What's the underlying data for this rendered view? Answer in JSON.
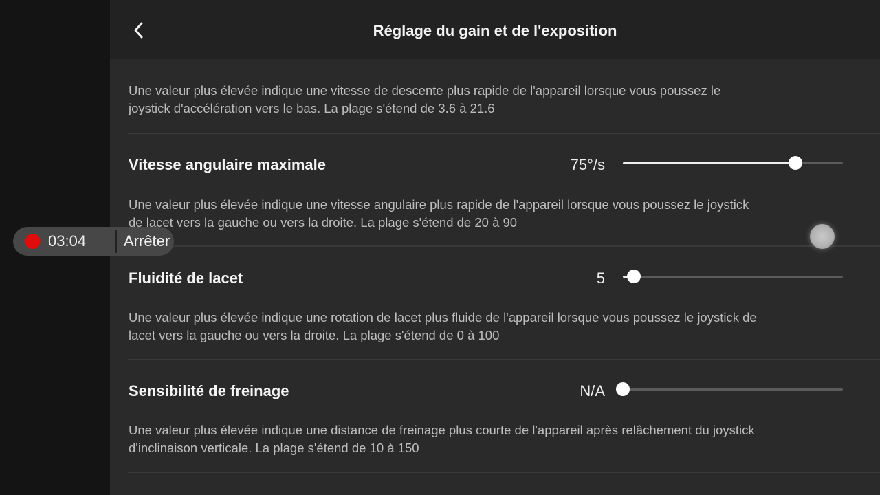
{
  "header": {
    "title": "Réglage du gain et de l'exposition"
  },
  "intro": {
    "description": "Une valeur plus élevée indique une vitesse de descente plus rapide de l'appareil lorsque vous poussez le\njoystick d'accélération vers le bas. La plage s'étend de 3.6 à 21.6"
  },
  "settings": [
    {
      "label": "Vitesse angulaire maximale",
      "value": "75°/s",
      "slider_fraction": 0.784,
      "description": "Une valeur plus élevée indique une vitesse angulaire plus rapide de l'appareil lorsque vous poussez le joystick\nde lacet vers la gauche ou vers la droite. La plage s'étend de 20 à 90"
    },
    {
      "label": "Fluidité de lacet",
      "value": "5",
      "slider_fraction": 0.05,
      "description": "Une valeur plus élevée indique une rotation de lacet plus fluide de l'appareil lorsque vous poussez le joystick de\nlacet vers la gauche ou vers la droite. La plage s'étend de 0 à 100"
    },
    {
      "label": "Sensibilité de freinage",
      "value": "N/A",
      "slider_fraction": 0.0,
      "description": "Une valeur plus élevée indique une distance de freinage plus courte de l'appareil après relâchement du joystick\nd'inclinaison verticale. La plage s'étend de 10 à 150"
    }
  ],
  "recording": {
    "time": "03:04",
    "stop_label": "Arrêter",
    "dot_color": "#e00b0b"
  },
  "colors": {
    "panel_bg": "#2a2a2a",
    "header_bg": "#222222",
    "accent": "#ffffff"
  },
  "icons": {
    "back": "chevron-left-icon"
  }
}
